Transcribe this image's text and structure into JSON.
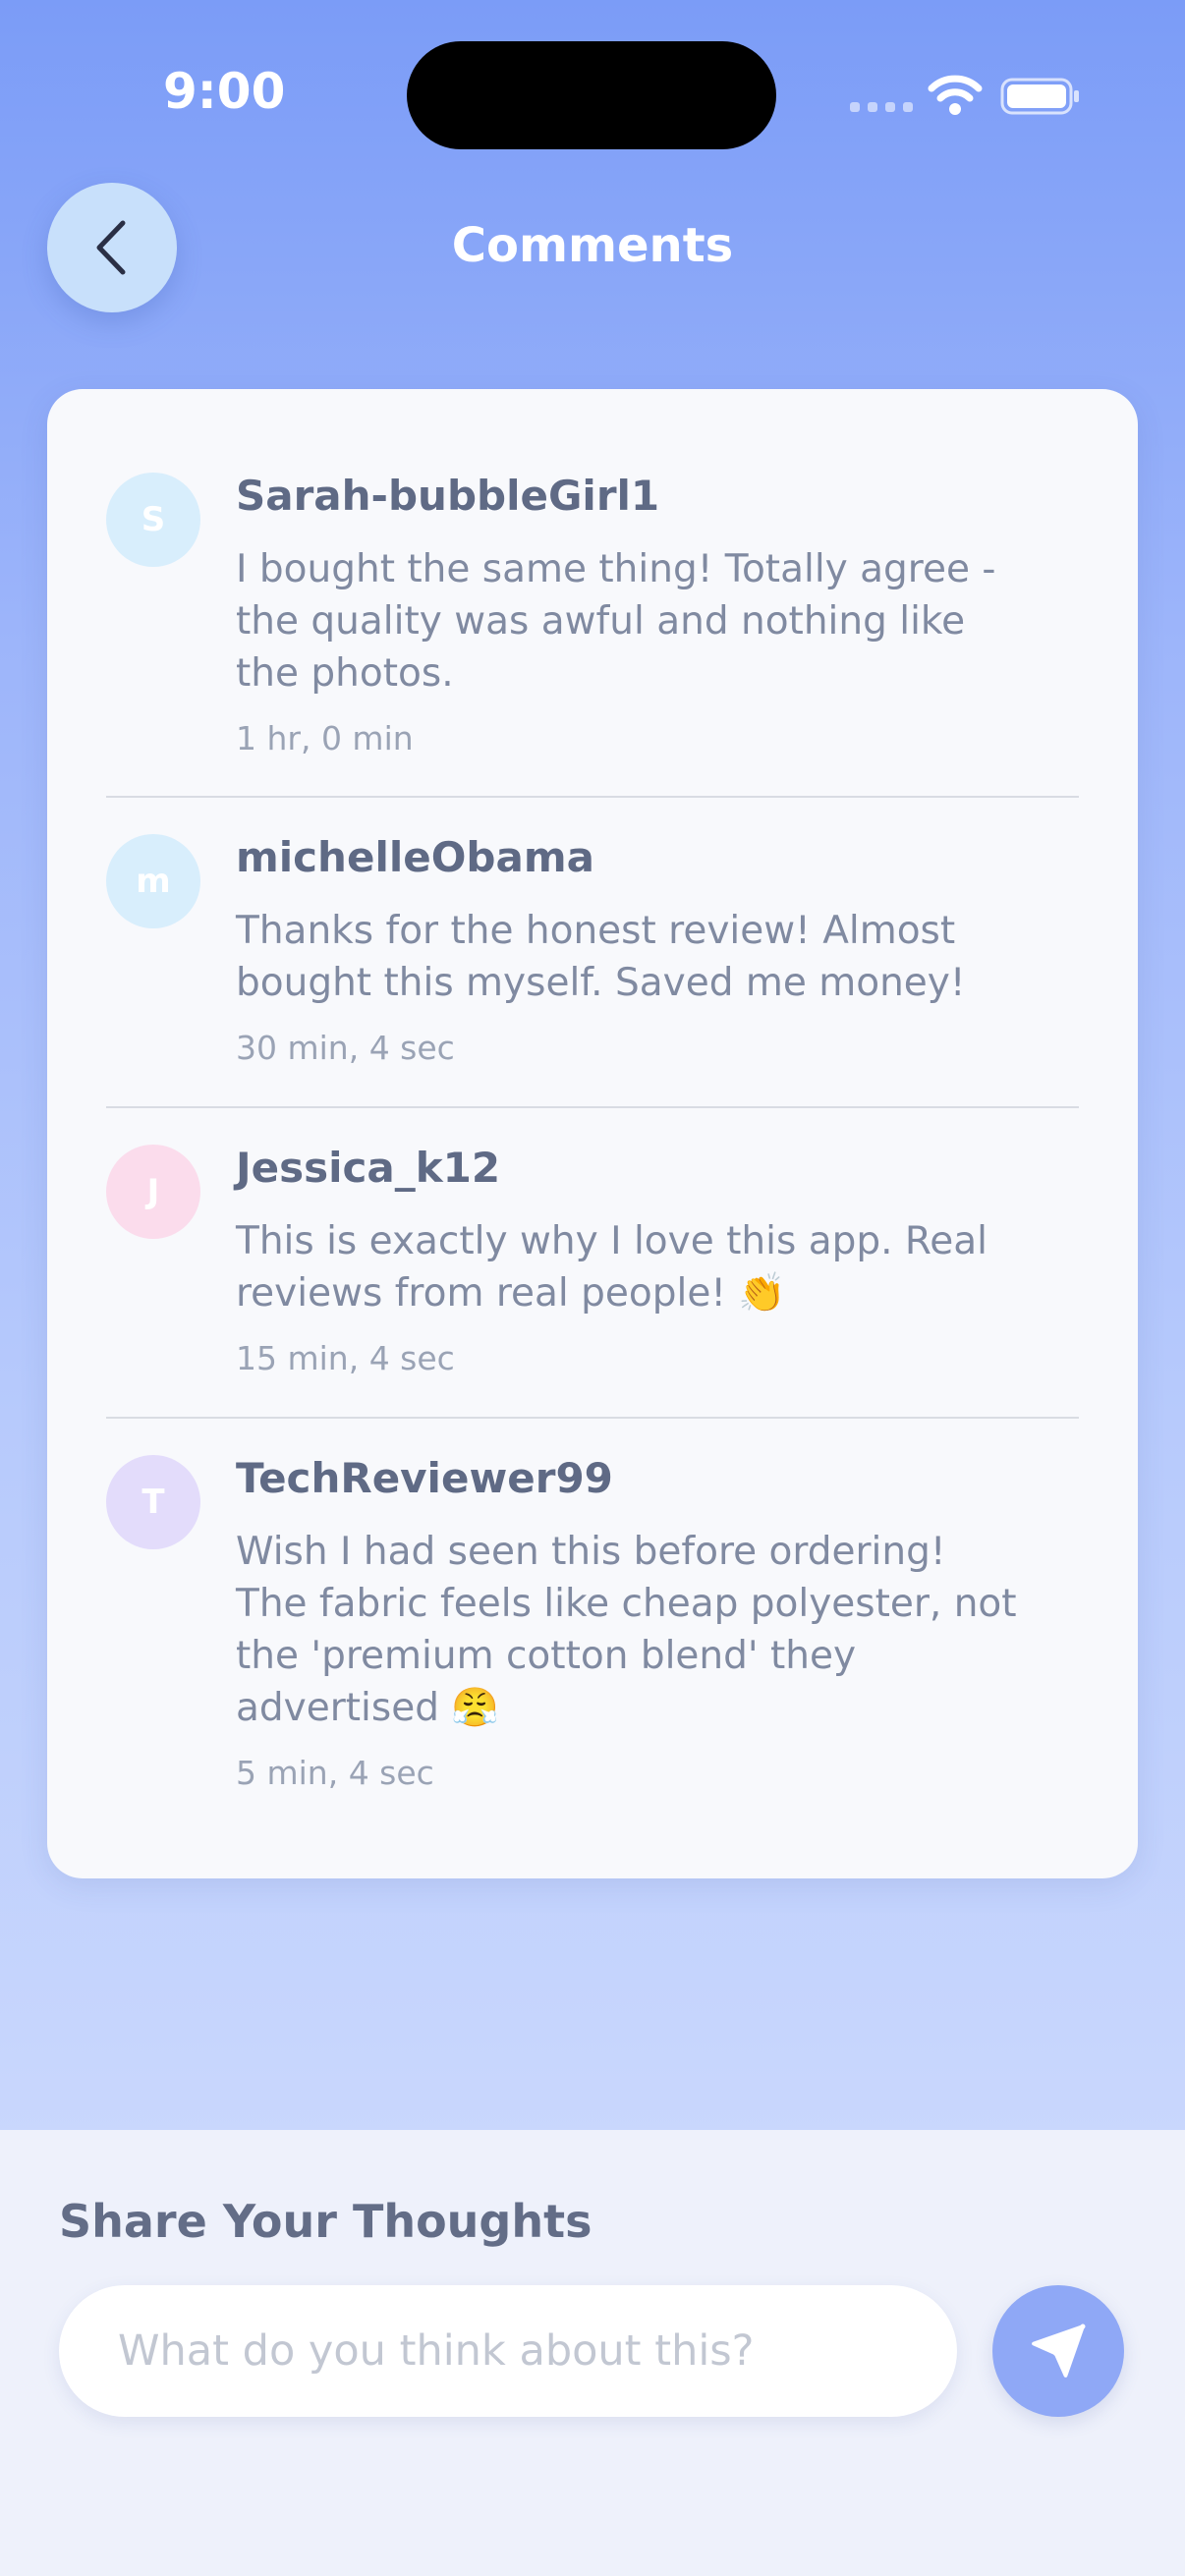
{
  "status_bar": {
    "time": "9:00"
  },
  "header": {
    "title": "Comments"
  },
  "comments": [
    {
      "initial": "S",
      "avatar_color": "#d8eefc",
      "username": "Sarah-bubbleGirl1",
      "text": "I bought the same thing! Totally agree - the quality was awful and nothing like the photos.",
      "time": "1 hr, 0 min"
    },
    {
      "initial": "m",
      "avatar_color": "#d8eefc",
      "username": "michelleObama",
      "text": "Thanks for the honest review! Almost bought this myself. Saved me money!",
      "time": "30 min, 4 sec"
    },
    {
      "initial": "J",
      "avatar_color": "#fbdcec",
      "username": "Jessica_k12",
      "text": "This is exactly why I love this app. Real reviews from real people! 👏",
      "time": "15 min, 4 sec"
    },
    {
      "initial": "T",
      "avatar_color": "#e3dcfb",
      "username": "TechReviewer99",
      "text": "Wish I had seen this before ordering! The fabric feels like cheap polyester, not the 'premium cotton blend' they advertised 😤",
      "time": "5 min, 4 sec"
    }
  ],
  "composer": {
    "title": "Share Your Thoughts",
    "placeholder": "What do you think about this?"
  },
  "icons": {
    "back": "chevron-left-icon",
    "send": "paper-plane-icon",
    "wifi": "wifi-icon",
    "battery": "battery-icon"
  }
}
